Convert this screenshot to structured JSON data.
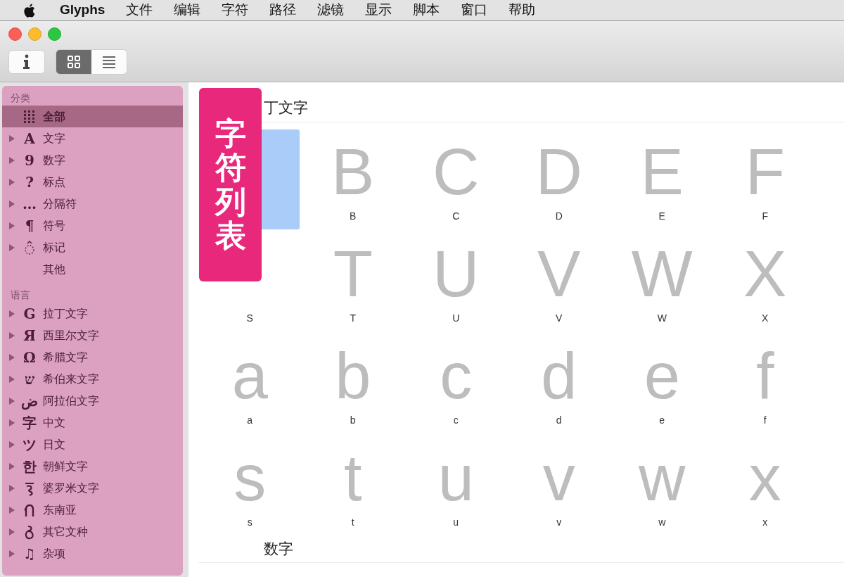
{
  "menu_bar": {
    "app": "Glyphs",
    "items": [
      "文件",
      "编辑",
      "字符",
      "路径",
      "滤镜",
      "显示",
      "脚本",
      "窗口",
      "帮助"
    ]
  },
  "toolbar": {
    "view_modes": [
      {
        "kind": "grid",
        "selected": true
      },
      {
        "kind": "list",
        "selected": false
      }
    ]
  },
  "sidebar": {
    "sections": [
      {
        "title": "分类",
        "items": [
          {
            "label": "全部",
            "kind": "leaf",
            "selected": true
          },
          {
            "icon": "A",
            "label": "文字",
            "kind": "group",
            "selected": false
          },
          {
            "icon": "9",
            "label": "数字",
            "kind": "group",
            "selected": false
          },
          {
            "icon": "?",
            "label": "标点",
            "kind": "group",
            "selected": false
          },
          {
            "icon": "…",
            "label": "分隔符",
            "kind": "group",
            "selected": false
          },
          {
            "icon": "¶",
            "label": "符号",
            "kind": "group",
            "selected": false
          },
          {
            "label": "标记",
            "kind": "group",
            "selected": false
          },
          {
            "label": "其他",
            "kind": "leaf",
            "selected": false
          }
        ]
      },
      {
        "title": "语言",
        "items": [
          {
            "icon": "G",
            "label": "拉丁文字",
            "kind": "group",
            "selected": false
          },
          {
            "icon": "Я",
            "label": "西里尔文字",
            "kind": "group",
            "selected": false
          },
          {
            "icon": "Ω",
            "label": "希腊文字",
            "kind": "group",
            "selected": false
          },
          {
            "icon": "ש",
            "label": "希伯来文字",
            "kind": "group",
            "selected": false
          },
          {
            "icon": "ض",
            "label": "阿拉伯文字",
            "kind": "group",
            "selected": false
          },
          {
            "icon": "字",
            "label": "中文",
            "kind": "group",
            "selected": false
          },
          {
            "icon": "ツ",
            "label": "日文",
            "kind": "group",
            "selected": false
          },
          {
            "icon": "한",
            "label": "朝鲜文字",
            "kind": "group",
            "selected": false
          },
          {
            "label": "婆罗米文字",
            "kind": "group",
            "selected": false
          },
          {
            "label": "东南亚",
            "kind": "group",
            "selected": false
          },
          {
            "label": "其它文种",
            "kind": "group",
            "selected": false
          },
          {
            "icon": "♫",
            "label": "杂项",
            "kind": "group",
            "selected": false
          }
        ]
      }
    ]
  },
  "caption": "字符列表",
  "content": {
    "sections": [
      {
        "title": "丁文字",
        "rows": [
          [
            {
              "selected": true
            },
            {
              "glyph": "B",
              "name": "B",
              "selected": false
            },
            {
              "glyph": "C",
              "name": "C",
              "selected": false
            },
            {
              "glyph": "D",
              "name": "D",
              "selected": false
            },
            {
              "glyph": "E",
              "name": "E",
              "selected": false
            },
            {
              "glyph": "F",
              "name": "F",
              "selected": false
            }
          ],
          [
            {
              "name": "S",
              "selected": false
            },
            {
              "glyph": "T",
              "name": "T",
              "selected": false
            },
            {
              "glyph": "U",
              "name": "U",
              "selected": false
            },
            {
              "glyph": "V",
              "name": "V",
              "selected": false
            },
            {
              "glyph": "W",
              "name": "W",
              "selected": false
            },
            {
              "glyph": "X",
              "name": "X",
              "selected": false
            }
          ],
          [
            {
              "glyph": "a",
              "name": "a",
              "selected": false
            },
            {
              "glyph": "b",
              "name": "b",
              "selected": false
            },
            {
              "glyph": "c",
              "name": "c",
              "selected": false
            },
            {
              "glyph": "d",
              "name": "d",
              "selected": false
            },
            {
              "glyph": "e",
              "name": "e",
              "selected": false
            },
            {
              "glyph": "f",
              "name": "f",
              "selected": false
            }
          ],
          [
            {
              "glyph": "s",
              "name": "s",
              "selected": false
            },
            {
              "glyph": "t",
              "name": "t",
              "selected": false
            },
            {
              "glyph": "u",
              "name": "u",
              "selected": false
            },
            {
              "glyph": "v",
              "name": "v",
              "selected": false
            },
            {
              "glyph": "w",
              "name": "w",
              "selected": false
            },
            {
              "glyph": "x",
              "name": "x",
              "selected": false
            }
          ]
        ]
      },
      {
        "title": "数字"
      }
    ]
  }
}
